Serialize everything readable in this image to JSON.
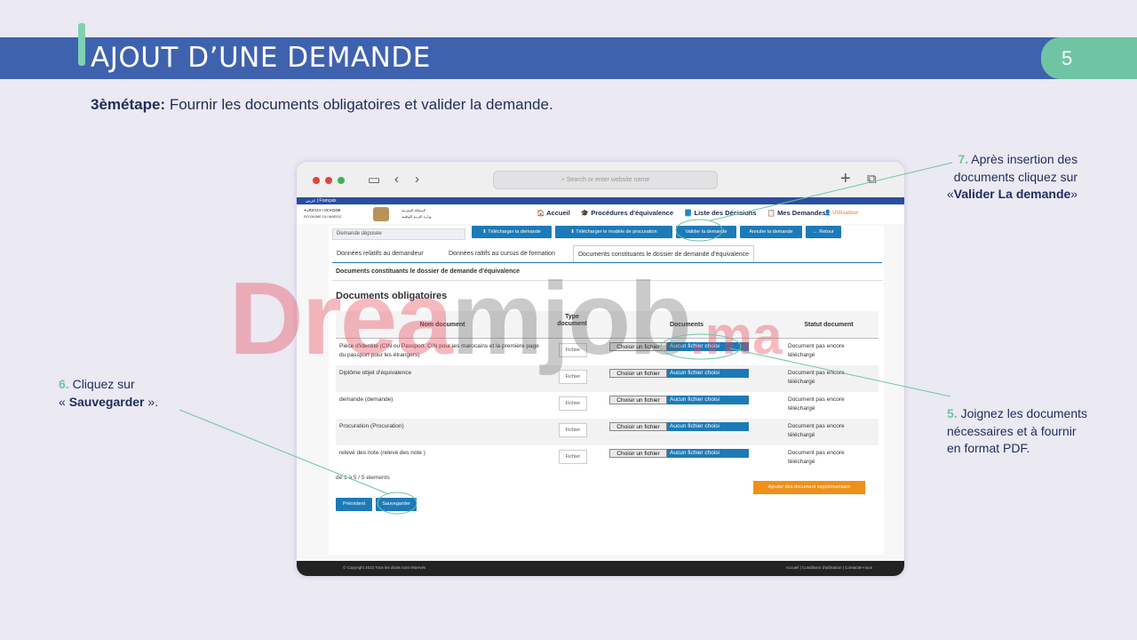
{
  "slide": {
    "title": "AJOUT D’UNE DEMANDE",
    "page_number": "5",
    "step_bold": "3èmétape:",
    "step_text": " Fournir les documents obligatoires et valider la demande."
  },
  "notes": {
    "n7": {
      "num": "7.",
      "line1": " Après insertion des",
      "line2": "documents cliquez sur",
      "pre": "«",
      "bold": "Valider La demande",
      "post": "»"
    },
    "n6": {
      "num": "6.",
      "line1": " Cliquez sur",
      "pre": "« ",
      "bold": "Sauvegarder",
      "post": " »."
    },
    "n5": {
      "num": "5.",
      "line1": " Joignez les documents",
      "line2": "nécessaires et à fournir",
      "line3": "en format PDF."
    }
  },
  "browser": {
    "url_placeholder": "Search or enter website name"
  },
  "site": {
    "topbar": "عربي | Français",
    "logo_left_1": "ⵜⴰⴳⵍⴷⵉⵜ ⵏ ⵍⵎⵖⵔⵉⴱ",
    "logo_left_2": "ROYAUME DU MAROC",
    "logo_right_1": "المملكة المغربية",
    "logo_right_2": "وزارة التربية الوطنية",
    "nav": [
      "🏠 Accueil",
      "🎓 Procédures d'équivalence",
      "📘 Liste des Décisions",
      "📋 Mes Demandes"
    ],
    "user": "👤 Utilisateur",
    "state": "Demande déposée",
    "buttons": [
      "⬇ Télécharger la demande",
      "⬇ Télécharger le modèle de procuration",
      "Valider la demande",
      "Annuler la demande",
      "← Retour"
    ],
    "tabs": [
      "Données relatifs au demandeur",
      "Données raltifs au cursus de formation",
      "Documents constituants le dossier de demande d'équivalence"
    ],
    "section": "Documents constituants le dossier de demande d'équivalence",
    "heading": "Documents obligatoires",
    "columns": [
      "Nom document",
      "Type document",
      "Documents",
      "Statut document"
    ],
    "rows": [
      {
        "name": "Pièce d'identité (CIN ou Passport. CIN pour les marocains et la première page du passport pour les étrangers)",
        "type": "Fichier",
        "choose": "Choisir un fichier",
        "none": "Aucun fichier choisi",
        "status": "Document pas encore téléchargé"
      },
      {
        "name": "Diplôme objet d'équivalence",
        "type": "Fichier",
        "choose": "Choisir un fichier",
        "none": "Aucun fichier choisi",
        "status": "Document pas encore téléchargé"
      },
      {
        "name": "demande (demande)",
        "type": "Fichier",
        "choose": "Choisir un fichier",
        "none": "Aucun fichier choisi",
        "status": "Document pas encore téléchargé"
      },
      {
        "name": "Procuration (Procuration)",
        "type": "Fichier",
        "choose": "Choisir un fichier",
        "none": "Aucun fichier choisi",
        "status": "Document pas encore téléchargé"
      },
      {
        "name": "relevé des note (relevé des note )",
        "type": "Fichier",
        "choose": "Choisir un fichier",
        "none": "Aucun fichier choisi",
        "status": "Document pas encore téléchargé"
      }
    ],
    "pagination": "de 1 à 5 / 5 elements",
    "add_button": "Ajouter des document supplémentaire",
    "prev_button": "Précédent",
    "save_button": "Sauvegarder",
    "footer_left": "© Copyright 2022 Tous les droits sont réservés",
    "footer_right": "Accueil  |  Conditions d'utilisation  |  Contacter-nous"
  },
  "watermark": {
    "part1": "Drea",
    "part2": "mjob",
    "part3": ".ma"
  },
  "colors": {
    "header": "#3f62ae",
    "accent": "#6fc5a3",
    "button": "#1d7ab8",
    "orange": "#f0901a"
  }
}
